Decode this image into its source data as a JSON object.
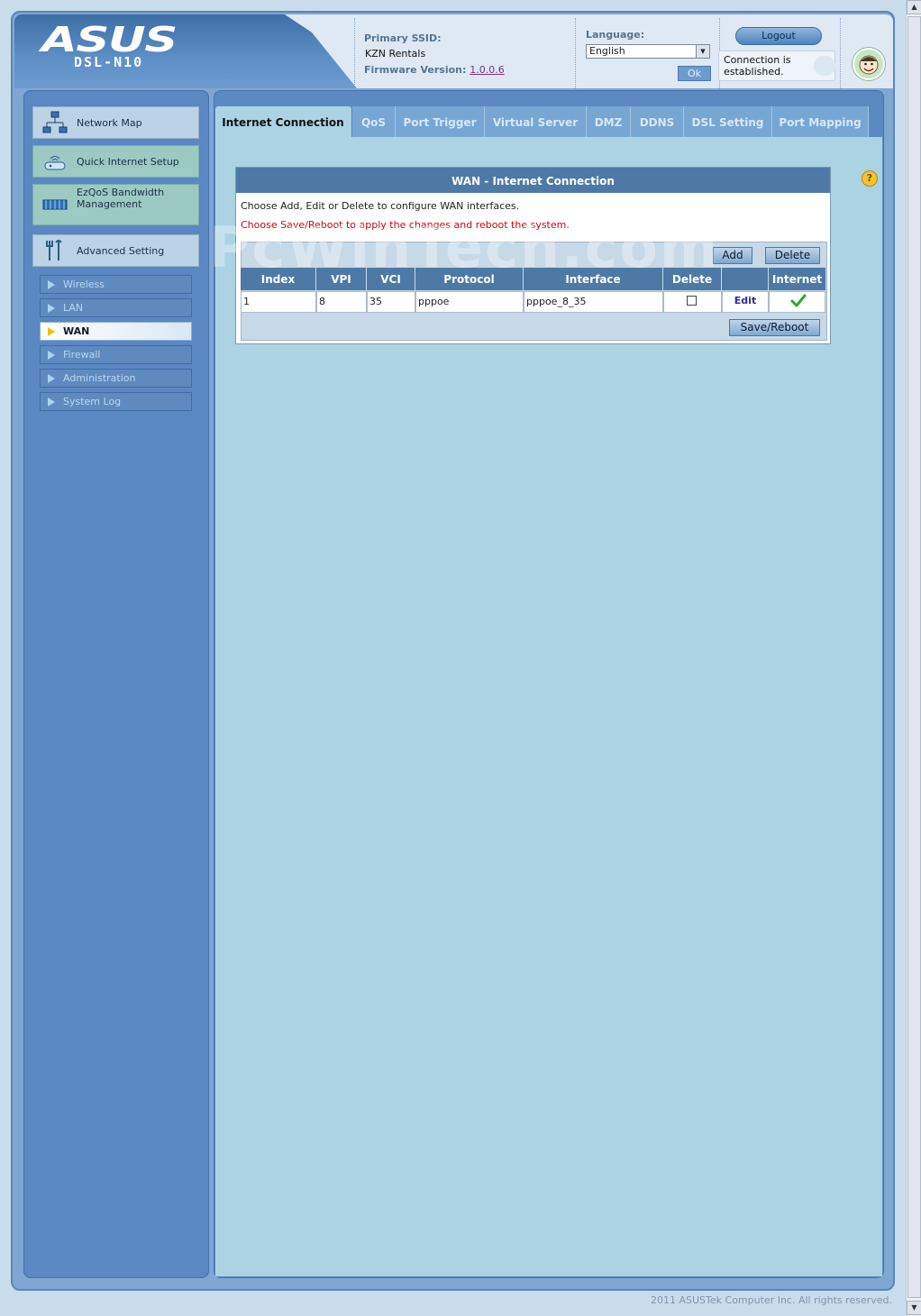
{
  "header": {
    "brand": "ASUS",
    "model": "DSL-N10",
    "primary_ssid_label": "Primary SSID:",
    "primary_ssid_value": "KZN Rentals",
    "firmware_label": "Firmware Version:",
    "firmware_value": "1.0.0.6",
    "language_label": "Language:",
    "language_value": "English",
    "ok_label": "Ok",
    "logout_label": "Logout",
    "connection_status": "Connection is established."
  },
  "sidebar": {
    "main_items": [
      {
        "label": "Network Map",
        "icon": "network-map-icon"
      },
      {
        "label": "Quick Internet Setup",
        "icon": "router-icon"
      },
      {
        "label": "EzQoS Bandwidth Management",
        "icon": "bandwidth-icon"
      },
      {
        "label": "Advanced Setting",
        "icon": "tools-icon"
      }
    ],
    "sub_items": [
      {
        "label": "Wireless"
      },
      {
        "label": "LAN"
      },
      {
        "label": "WAN"
      },
      {
        "label": "Firewall"
      },
      {
        "label": "Administration"
      },
      {
        "label": "System Log"
      }
    ],
    "active_sub_item": "WAN"
  },
  "tabs": [
    {
      "label": "Internet Connection"
    },
    {
      "label": "QoS"
    },
    {
      "label": "Port Trigger"
    },
    {
      "label": "Virtual Server"
    },
    {
      "label": "DMZ"
    },
    {
      "label": "DDNS"
    },
    {
      "label": "DSL Setting"
    },
    {
      "label": "Port Mapping"
    }
  ],
  "active_tab": "Internet Connection",
  "wan": {
    "title": "WAN - Internet Connection",
    "desc1": "Choose Add, Edit or Delete to configure WAN interfaces.",
    "desc2": "Choose Save/Reboot to apply the changes and reboot the system.",
    "add_label": "Add",
    "delete_label": "Delete",
    "save_reboot_label": "Save/Reboot",
    "columns": [
      "Index",
      "VPI",
      "VCI",
      "Protocol",
      "Interface",
      "Delete",
      "",
      "Internet"
    ],
    "rows": [
      {
        "index": "1",
        "vpi": "8",
        "vci": "35",
        "protocol": "pppoe",
        "interface": "pppoe_8_35",
        "delete_checked": false,
        "edit_label": "Edit",
        "internet": "check-icon"
      }
    ]
  },
  "watermark": "PcWinTech.com",
  "footer": "2011 ASUSTek Computer Inc. All rights reserved.",
  "colors": {
    "header_blue": "#4e79a7",
    "panel_bg": "#abd3e3",
    "sidebar_bg": "#5b87c2",
    "warning_red": "#d7000f",
    "link_purple": "#7a2e8f",
    "active_yellow": "#e9c400"
  }
}
